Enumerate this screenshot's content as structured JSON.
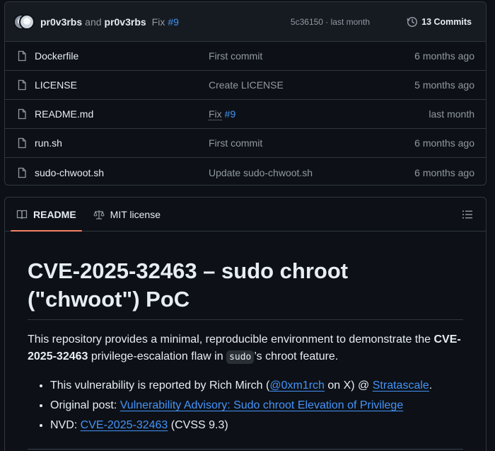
{
  "commit": {
    "author1": "pr0v3rbs",
    "and": "and",
    "author2": "pr0v3rbs",
    "message": "Fix",
    "issue": "#9",
    "meta": "5c36150 · last month",
    "commits_label": "13 Commits"
  },
  "files": [
    {
      "name": "Dockerfile",
      "message": "First commit",
      "time": "6 months ago"
    },
    {
      "name": "LICENSE",
      "message": "Create LICENSE",
      "time": "5 months ago"
    },
    {
      "name": "README.md",
      "message": "Fix",
      "issue": "#9",
      "time": "last month"
    },
    {
      "name": "run.sh",
      "message": "First commit",
      "time": "6 months ago"
    },
    {
      "name": "sudo-chwoot.sh",
      "message": "Update sudo-chwoot.sh",
      "time": "6 months ago"
    }
  ],
  "tabs": {
    "readme": "README",
    "license": "MIT license"
  },
  "readme": {
    "title": "CVE-2025-32463 – sudo chroot (\"chwoot\") PoC",
    "intro_1": "This repository provides a minimal, reproducible environment to demonstrate the ",
    "intro_bold": "CVE-2025-32463",
    "intro_2": " privilege-escalation flaw in ",
    "intro_code": "sudo",
    "intro_3": "’s chroot feature.",
    "bullet1_pre": "This vulnerability is reported by Rich Mirch (",
    "bullet1_link1": "@0xm1rch",
    "bullet1_mid": " on X) @ ",
    "bullet1_link2": "Stratascale",
    "bullet1_post": ".",
    "bullet2_pre": "Original post: ",
    "bullet2_link": "Vulnerability Advisory: Sudo chroot Elevation of Privilege",
    "bullet3_pre": "NVD: ",
    "bullet3_link": "CVE-2025-32463",
    "bullet3_post": " (CVSS 9.3)"
  },
  "colors": {
    "background": "#0d1117",
    "link": "#4493f8",
    "active_tab": "#f78166",
    "border": "#30363d"
  }
}
